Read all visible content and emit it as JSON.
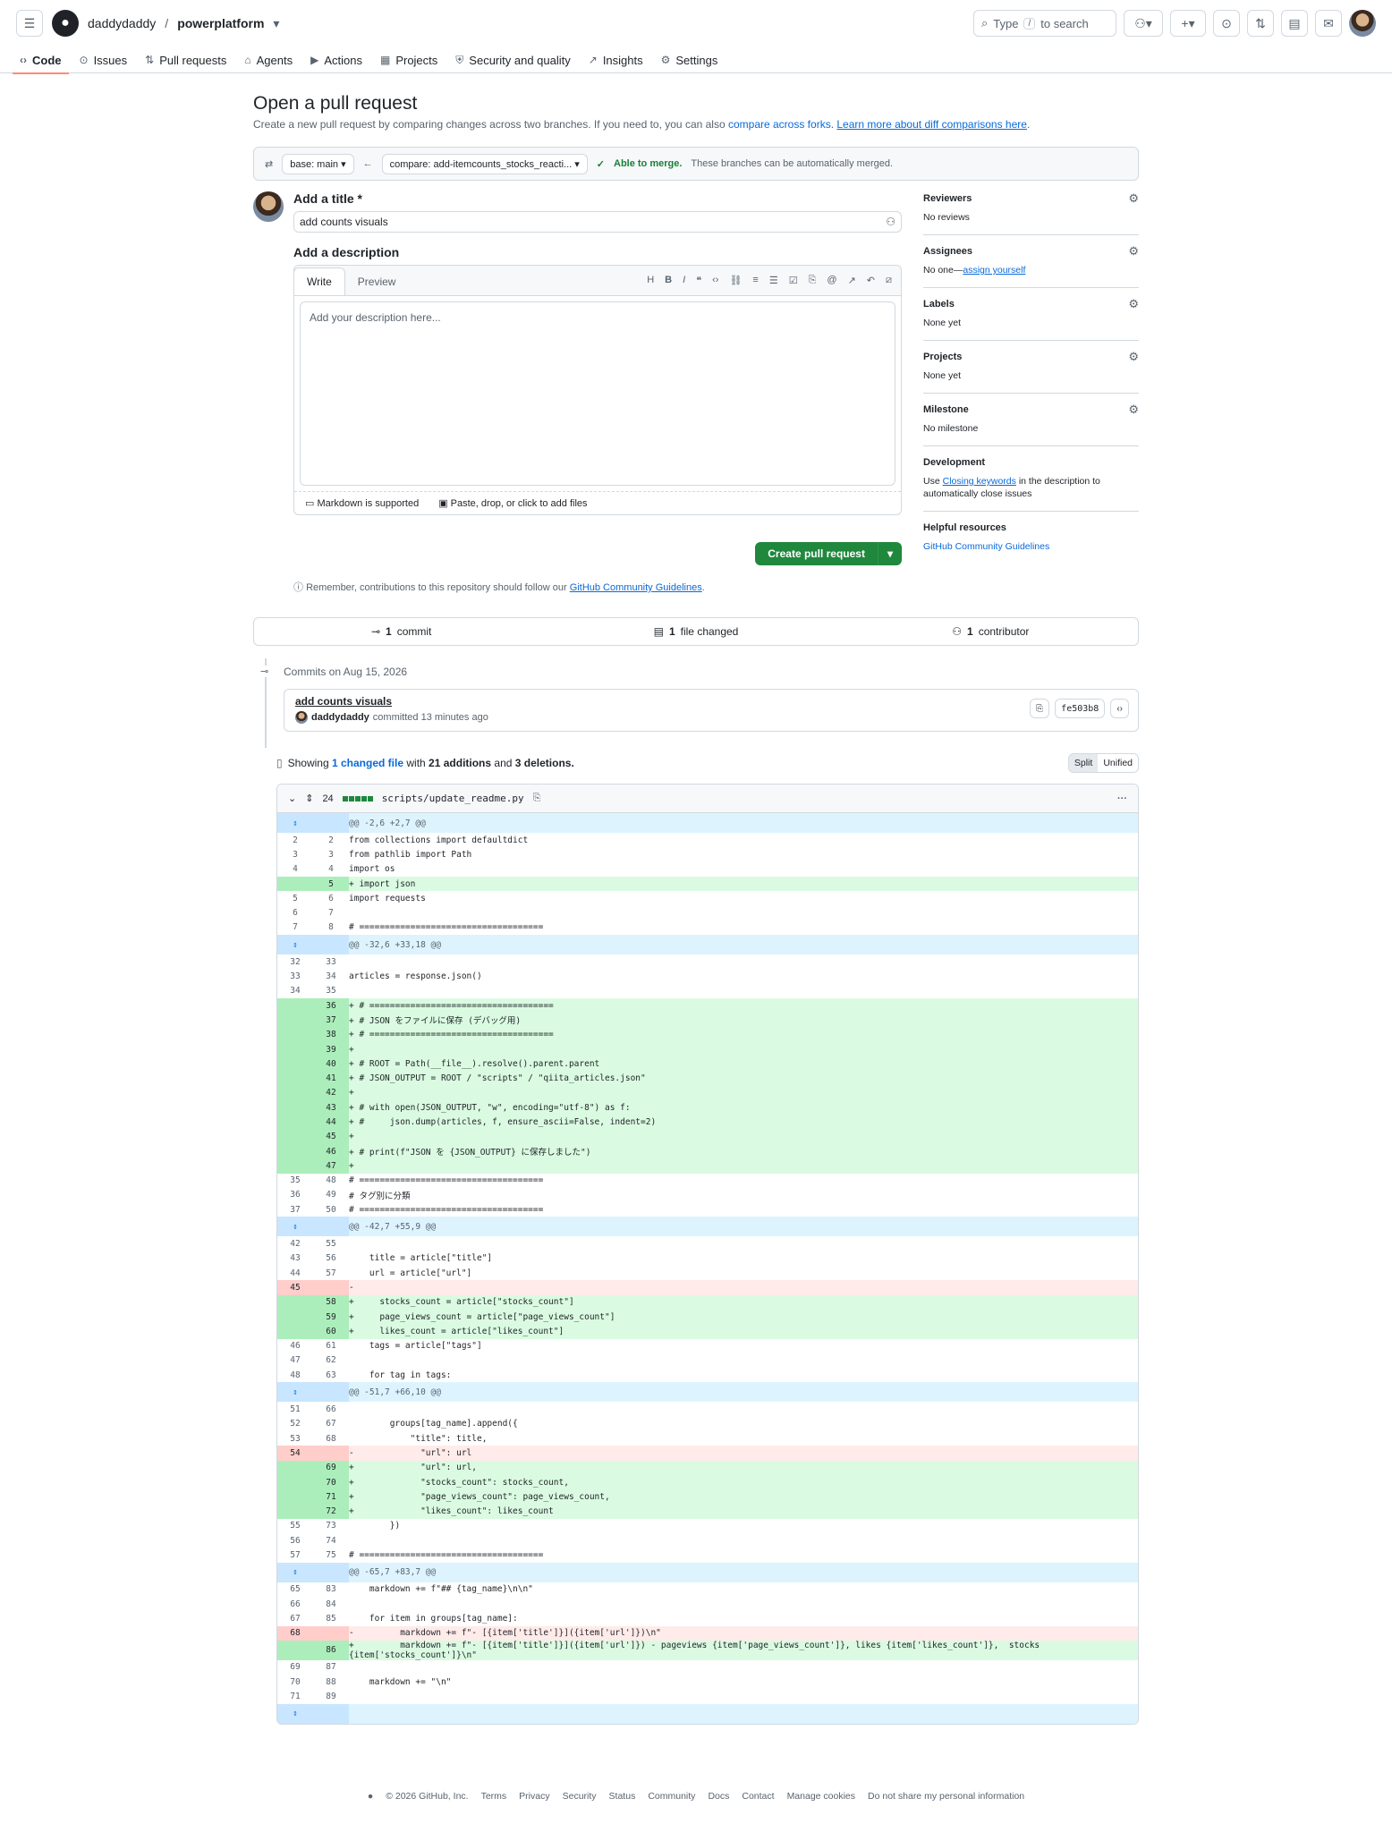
{
  "header": {
    "owner": "daddydaddy",
    "repo": "powerplatform",
    "search_pre": "Type",
    "search_key": "/",
    "search_post": "to search"
  },
  "nav": [
    {
      "icon": "‹›",
      "label": "Code"
    },
    {
      "icon": "⊙",
      "label": "Issues"
    },
    {
      "icon": "⇅",
      "label": "Pull requests"
    },
    {
      "icon": "⌂",
      "label": "Agents"
    },
    {
      "icon": "▶",
      "label": "Actions"
    },
    {
      "icon": "▦",
      "label": "Projects"
    },
    {
      "icon": "⛨",
      "label": "Security and quality"
    },
    {
      "icon": "↗",
      "label": "Insights"
    },
    {
      "icon": "⚙",
      "label": "Settings"
    }
  ],
  "page": {
    "title": "Open a pull request",
    "subtitle": "Create a new pull request by comparing changes across two branches. If you need to, you can also",
    "link_forks": "compare across forks.",
    "link_learn": "Learn more about diff comparisons here"
  },
  "range": {
    "base": "base: main",
    "compare": "compare: add-itemcounts_stocks_reacti...",
    "able": "Able to merge.",
    "able_desc": "These branches can be automatically merged."
  },
  "form": {
    "title_label": "Add a title *",
    "title_value": "add counts visuals",
    "desc_label": "Add a description",
    "tab_write": "Write",
    "tab_preview": "Preview",
    "placeholder": "Add your description here...",
    "markdown": "Markdown is supported",
    "attach": "Paste, drop, or click to add files",
    "create": "Create pull request",
    "remember_pre": "Remember, contributions to this repository should follow our",
    "remember_link": "GitHub Community Guidelines"
  },
  "sidebar": [
    {
      "title": "Reviewers",
      "value": "No reviews",
      "gear": true
    },
    {
      "title": "Assignees",
      "value": "No one—",
      "link": "assign yourself",
      "gear": true
    },
    {
      "title": "Labels",
      "value": "None yet",
      "gear": true
    },
    {
      "title": "Projects",
      "value": "None yet",
      "gear": true
    },
    {
      "title": "Milestone",
      "value": "No milestone",
      "gear": true
    }
  ],
  "development": {
    "title": "Development",
    "pre": "Use",
    "link": "Closing keywords",
    "post": "in the description to automatically close issues"
  },
  "helpful": {
    "title": "Helpful resources",
    "link": "GitHub Community Guidelines"
  },
  "stats": {
    "commits_n": "1",
    "commits": "commit",
    "files_n": "1",
    "files": "file changed",
    "contrib_n": "1",
    "contrib": "contributor"
  },
  "commits": {
    "date": "Commits on Aug 15, 2026",
    "title": "add counts visuals",
    "author": "daddydaddy",
    "meta": "committed 13 minutes ago",
    "sha": "fe503b8"
  },
  "diffsummary": {
    "pre": "Showing",
    "link": "1 changed file",
    "mid": "with",
    "adds": "21 additions",
    "and": "and",
    "dels": "3 deletions.",
    "split": "Split",
    "unified": "Unified"
  },
  "file": {
    "count": "24",
    "path": "scripts/update_readme.py"
  },
  "diff": [
    {
      "t": "hunk",
      "o": "",
      "n": "",
      "c": "@@ -2,6 +2,7 @@"
    },
    {
      "t": "ctx",
      "o": "2",
      "n": "2",
      "c": "from collections import defaultdict"
    },
    {
      "t": "ctx",
      "o": "3",
      "n": "3",
      "c": "from pathlib import Path"
    },
    {
      "t": "ctx",
      "o": "4",
      "n": "4",
      "c": "import os"
    },
    {
      "t": "add",
      "o": "",
      "n": "5",
      "c": "+ import json"
    },
    {
      "t": "ctx",
      "o": "5",
      "n": "6",
      "c": "import requests"
    },
    {
      "t": "ctx",
      "o": "6",
      "n": "7",
      "c": ""
    },
    {
      "t": "ctx",
      "o": "7",
      "n": "8",
      "c": "# ===================================="
    },
    {
      "t": "hunk",
      "o": "",
      "n": "",
      "c": "@@ -32,6 +33,18 @@"
    },
    {
      "t": "ctx",
      "o": "32",
      "n": "33",
      "c": ""
    },
    {
      "t": "ctx",
      "o": "33",
      "n": "34",
      "c": "articles = response.json()"
    },
    {
      "t": "ctx",
      "o": "34",
      "n": "35",
      "c": ""
    },
    {
      "t": "add",
      "o": "",
      "n": "36",
      "c": "+ # ===================================="
    },
    {
      "t": "add",
      "o": "",
      "n": "37",
      "c": "+ # JSON をファイルに保存 (デバッグ用)"
    },
    {
      "t": "add",
      "o": "",
      "n": "38",
      "c": "+ # ===================================="
    },
    {
      "t": "add",
      "o": "",
      "n": "39",
      "c": "+"
    },
    {
      "t": "add",
      "o": "",
      "n": "40",
      "c": "+ # ROOT = Path(__file__).resolve().parent.parent"
    },
    {
      "t": "add",
      "o": "",
      "n": "41",
      "c": "+ # JSON_OUTPUT = ROOT / \"scripts\" / \"qiita_articles.json\""
    },
    {
      "t": "add",
      "o": "",
      "n": "42",
      "c": "+"
    },
    {
      "t": "add",
      "o": "",
      "n": "43",
      "c": "+ # with open(JSON_OUTPUT, \"w\", encoding=\"utf-8\") as f:"
    },
    {
      "t": "add",
      "o": "",
      "n": "44",
      "c": "+ #     json.dump(articles, f, ensure_ascii=False, indent=2)"
    },
    {
      "t": "add",
      "o": "",
      "n": "45",
      "c": "+"
    },
    {
      "t": "add",
      "o": "",
      "n": "46",
      "c": "+ # print(f\"JSON を {JSON_OUTPUT} に保存しました\")"
    },
    {
      "t": "add",
      "o": "",
      "n": "47",
      "c": "+"
    },
    {
      "t": "ctx",
      "o": "35",
      "n": "48",
      "c": "# ===================================="
    },
    {
      "t": "ctx",
      "o": "36",
      "n": "49",
      "c": "# タグ別に分類"
    },
    {
      "t": "ctx",
      "o": "37",
      "n": "50",
      "c": "# ===================================="
    },
    {
      "t": "hunk",
      "o": "",
      "n": "",
      "c": "@@ -42,7 +55,9 @@"
    },
    {
      "t": "ctx",
      "o": "42",
      "n": "55",
      "c": ""
    },
    {
      "t": "ctx",
      "o": "43",
      "n": "56",
      "c": "    title = article[\"title\"]"
    },
    {
      "t": "ctx",
      "o": "44",
      "n": "57",
      "c": "    url = article[\"url\"]"
    },
    {
      "t": "del",
      "o": "45",
      "n": "",
      "c": "-"
    },
    {
      "t": "add",
      "o": "",
      "n": "58",
      "c": "+     stocks_count = article[\"stocks_count\"]"
    },
    {
      "t": "add",
      "o": "",
      "n": "59",
      "c": "+     page_views_count = article[\"page_views_count\"]"
    },
    {
      "t": "add",
      "o": "",
      "n": "60",
      "c": "+     likes_count = article[\"likes_count\"]"
    },
    {
      "t": "ctx",
      "o": "46",
      "n": "61",
      "c": "    tags = article[\"tags\"]"
    },
    {
      "t": "ctx",
      "o": "47",
      "n": "62",
      "c": ""
    },
    {
      "t": "ctx",
      "o": "48",
      "n": "63",
      "c": "    for tag in tags:"
    },
    {
      "t": "hunk",
      "o": "",
      "n": "",
      "c": "@@ -51,7 +66,10 @@"
    },
    {
      "t": "ctx",
      "o": "51",
      "n": "66",
      "c": ""
    },
    {
      "t": "ctx",
      "o": "52",
      "n": "67",
      "c": "        groups[tag_name].append({"
    },
    {
      "t": "ctx",
      "o": "53",
      "n": "68",
      "c": "            \"title\": title,"
    },
    {
      "t": "del",
      "o": "54",
      "n": "",
      "c": "-             \"url\": url"
    },
    {
      "t": "add",
      "o": "",
      "n": "69",
      "c": "+             \"url\": url,"
    },
    {
      "t": "add",
      "o": "",
      "n": "70",
      "c": "+             \"stocks_count\": stocks_count,"
    },
    {
      "t": "add",
      "o": "",
      "n": "71",
      "c": "+             \"page_views_count\": page_views_count,"
    },
    {
      "t": "add",
      "o": "",
      "n": "72",
      "c": "+             \"likes_count\": likes_count"
    },
    {
      "t": "ctx",
      "o": "55",
      "n": "73",
      "c": "        })"
    },
    {
      "t": "ctx",
      "o": "56",
      "n": "74",
      "c": ""
    },
    {
      "t": "ctx",
      "o": "57",
      "n": "75",
      "c": "# ===================================="
    },
    {
      "t": "hunk",
      "o": "",
      "n": "",
      "c": "@@ -65,7 +83,7 @@"
    },
    {
      "t": "ctx",
      "o": "65",
      "n": "83",
      "c": "    markdown += f\"## {tag_name}\\n\\n\""
    },
    {
      "t": "ctx",
      "o": "66",
      "n": "84",
      "c": ""
    },
    {
      "t": "ctx",
      "o": "67",
      "n": "85",
      "c": "    for item in groups[tag_name]:"
    },
    {
      "t": "del",
      "o": "68",
      "n": "",
      "c": "-         markdown += f\"- [{item['title']}]({item['url']})\\n\""
    },
    {
      "t": "add",
      "o": "",
      "n": "86",
      "c": "+         markdown += f\"- [{item['title']}]({item['url']}) - pageviews {item['page_views_count']}, likes {item['likes_count']},  stocks {item['stocks_count']}\\n\"",
      "wrap": true
    },
    {
      "t": "ctx",
      "o": "69",
      "n": "87",
      "c": ""
    },
    {
      "t": "ctx",
      "o": "70",
      "n": "88",
      "c": "    markdown += \"\\n\""
    },
    {
      "t": "ctx",
      "o": "71",
      "n": "89",
      "c": ""
    },
    {
      "t": "hunk",
      "o": "",
      "n": "",
      "c": ""
    }
  ],
  "footer": [
    "© 2026 GitHub, Inc.",
    "Terms",
    "Privacy",
    "Security",
    "Status",
    "Community",
    "Docs",
    "Contact",
    "Manage cookies",
    "Do not share my personal information"
  ]
}
